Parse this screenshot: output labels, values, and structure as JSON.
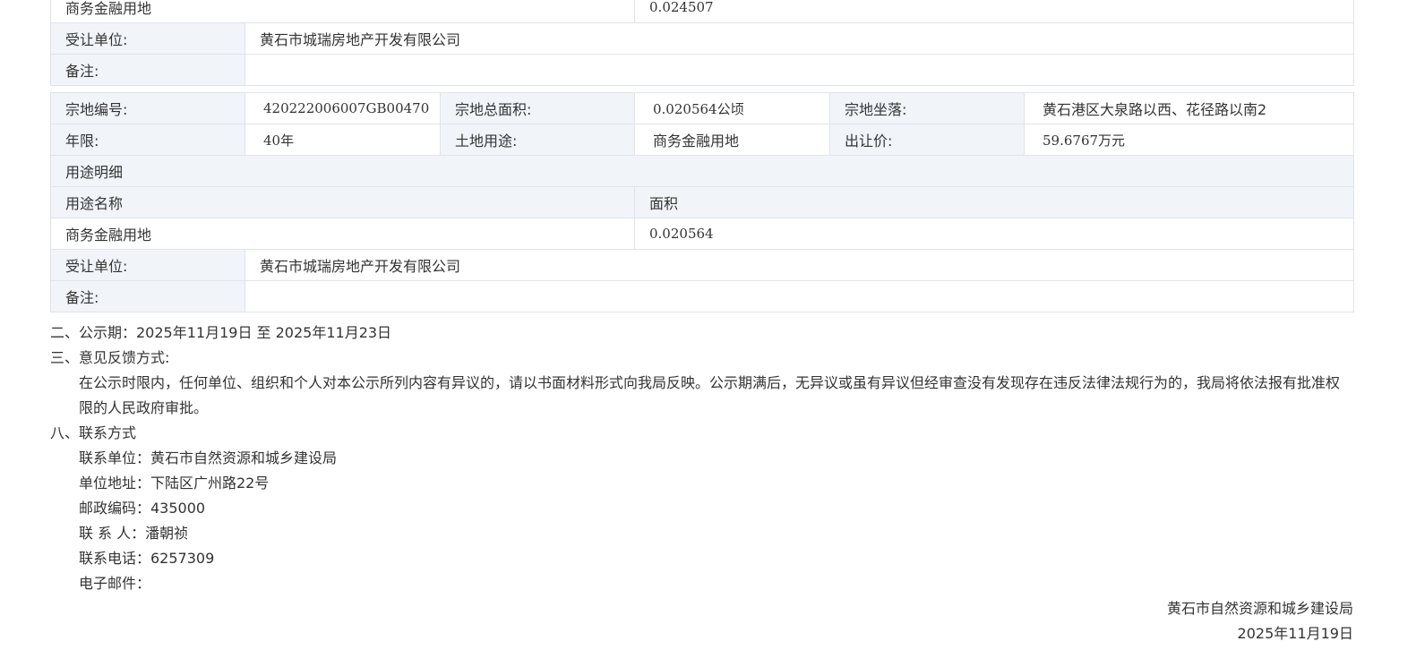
{
  "table1": {
    "use_name": "商务金融用地",
    "use_area": "0.024507",
    "transferee_label": "受让单位:",
    "transferee": "黄石市城瑞房地产开发有限公司",
    "remark_label": "备注:",
    "remark": ""
  },
  "table2": {
    "parcel_no_label": "宗地编号:",
    "parcel_no": "420222006007GB00470",
    "total_area_label": "宗地总面积:",
    "total_area": "0.020564公顷",
    "location_label": "宗地坐落:",
    "location": "黄石港区大泉路以西、花径路以南2",
    "term_label": "年限:",
    "term": "40年",
    "land_use_label": "土地用途:",
    "land_use": "商务金融用地",
    "price_label": "出让价:",
    "price": "59.6767万元",
    "use_detail_header": "用途明细",
    "use_name_header": "用途名称",
    "area_header": "面积",
    "use_name": "商务金融用地",
    "use_area": "0.020564",
    "transferee_label": "受让单位:",
    "transferee": "黄石市城瑞房地产开发有限公司",
    "remark_label": "备注:",
    "remark": ""
  },
  "notice": {
    "period": "二、公示期：2025年11月19日 至 2025年11月23日",
    "feedback_title": "三、意见反馈方式:",
    "feedback_text": "在公示时限内，任何单位、组织和个人对本公示所列内容有异议的，请以书面材料形式向我局反映。公示期满后，无异议或虽有异议但经审查没有发现存在违反法律法规行为的，我局将依法报有批准权限的人民政府审批。",
    "contact_title": "八、联系方式",
    "contact_unit": "联系单位：黄石市自然资源和城乡建设局",
    "address": "单位地址：下陆区广州路22号",
    "postcode": "邮政编码：435000",
    "contact_person": "联 系 人：潘朝祯",
    "phone": "联系电话：6257309",
    "email": "电子邮件：",
    "signature": "黄石市自然资源和城乡建设局",
    "date": "2025年11月19日"
  }
}
